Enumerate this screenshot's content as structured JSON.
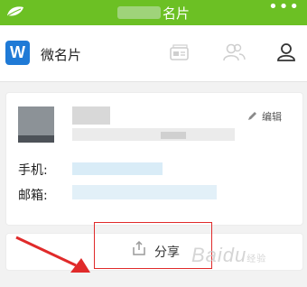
{
  "header": {
    "title_visible": "名片",
    "background_color": "#6cc024",
    "leaf_icon": "leaf-icon",
    "more_icon": "more-dots-icon"
  },
  "app": {
    "logo_letter": "W",
    "name": "微名片",
    "logo_color": "#1f7ad6"
  },
  "toolbar": {
    "icons": [
      "card-icon",
      "contacts-icon",
      "profile-icon"
    ]
  },
  "card": {
    "edit_label": "编辑",
    "phone_label": "手机:",
    "email_label": "邮箱:"
  },
  "share": {
    "label": "分享",
    "icon": "share-icon"
  },
  "annotation": {
    "highlight_color": "#e02a2a"
  },
  "watermark": {
    "text": "Baidu",
    "sub": "经验"
  }
}
